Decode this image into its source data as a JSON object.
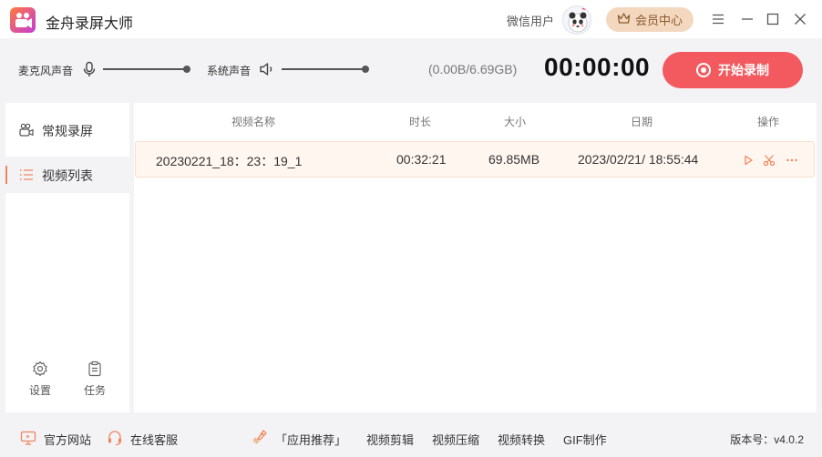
{
  "app": {
    "title": "金舟录屏大师",
    "user_name": "微信用户",
    "vip_label": "会员中心",
    "icons": [
      "camera-logo-icon",
      "crown-icon",
      "menu-icon",
      "minimize-icon",
      "maximize-icon",
      "close-icon"
    ]
  },
  "controls": {
    "mic_label": "麦克风声音",
    "system_label": "系统声音",
    "storage": "(0.00B/6.69GB)",
    "timer": "00:00:00",
    "start_label": "开始录制"
  },
  "sidebar": {
    "items": [
      {
        "label": "常规录屏",
        "icon": "camera-icon",
        "active": false
      },
      {
        "label": "视频列表",
        "icon": "list-icon",
        "active": true
      }
    ],
    "settings_label": "设置",
    "tasks_label": "任务"
  },
  "table": {
    "headers": {
      "name": "视频名称",
      "duration": "时长",
      "size": "大小",
      "date": "日期",
      "actions": "操作"
    },
    "rows": [
      {
        "name": "20230221_18：23：19_1",
        "duration": "00:32:21",
        "size": "69.85MB",
        "date": "2023/02/21/ 18:55:44"
      }
    ]
  },
  "footer": {
    "website": "官方网站",
    "support": "在线客服",
    "recommend": "「应用推荐」",
    "links": [
      "视频剪辑",
      "视频压缩",
      "视频转换",
      "GIF制作"
    ],
    "version": "版本号：v4.0.2"
  },
  "colors": {
    "accent": "#f25a5f",
    "highlight": "#f0855a",
    "vip_bg": "#f3d8bf"
  }
}
